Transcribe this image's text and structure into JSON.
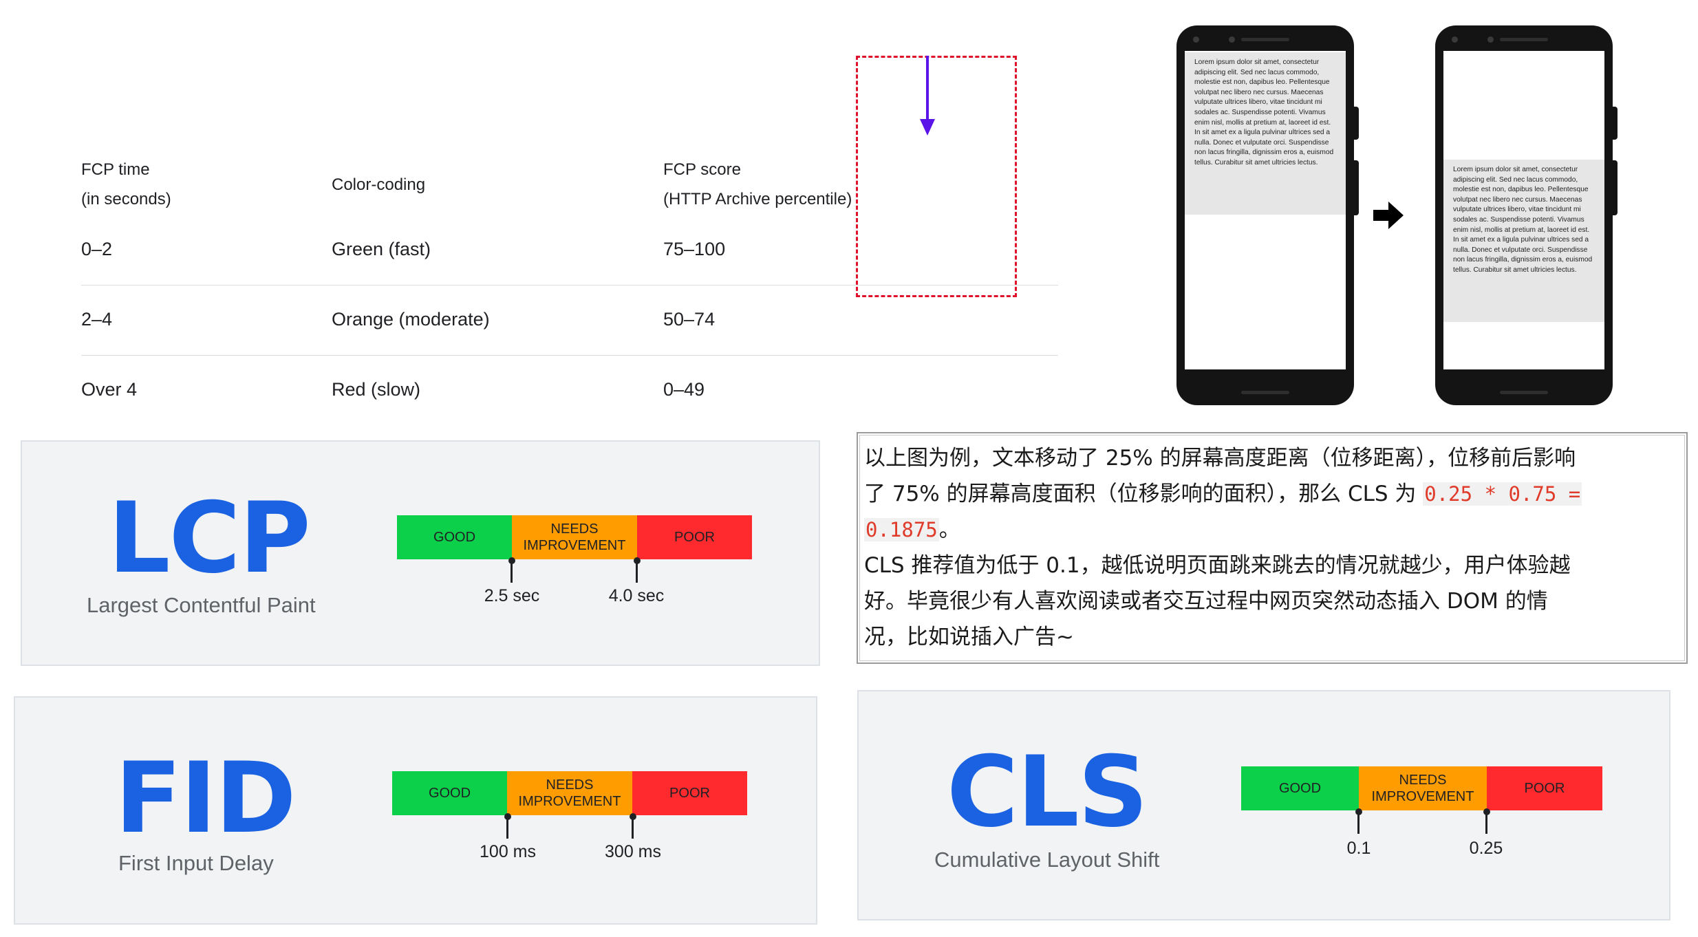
{
  "fcp_table": {
    "headers": {
      "time_line1": "FCP time",
      "time_line2": "(in seconds)",
      "color": "Color-coding",
      "score_line1": "FCP score",
      "score_line2": "(HTTP Archive percentile)"
    },
    "rows": [
      {
        "time": "0–2",
        "color": "Green (fast)",
        "score": "75–100"
      },
      {
        "time": "2–4",
        "color": "Orange (moderate)",
        "score": "50–74"
      },
      {
        "time": "Over 4",
        "color": "Red (slow)",
        "score": "0–49"
      }
    ]
  },
  "phones": {
    "lorem": "Lorem ipsum dolor sit amet, consectetur adipiscing elit. Sed nec lacus commodo, molestie est non, dapibus leo. Pellentesque volutpat nec libero nec cursus. Maecenas vulputate ultrices libero, vitae tincidunt mi sodales ac. Suspendisse potenti. Vivamus enim nisl, mollis at pretium at, laoreet id est. In sit amet ex a ligula pulvinar ultrices sed a nulla. Donec et vulputate orci. Suspendisse non lacus fringilla, dignissim eros a, euismod tellus. Curabitur sit amet ultricies lectus.",
    "colors": {
      "shift_border": "#e0112b",
      "shift_arrow": "#5a14e8"
    }
  },
  "note": {
    "line1": "以上图为例，文本移动了 25% 的屏幕高度距离（位移距离），位移前后影响",
    "line2_text": "了 75% 的屏幕高度面积（位移影响的面积），那么 CLS 为 ",
    "line2_code": "0.25 * 0.75 =",
    "line3_code": "0.1875",
    "line3_text": "。",
    "line4": "CLS 推荐值为低于 0.1，越低说明页面跳来跳去的情况就越少，用户体验越",
    "line5": "好。毕竟很少有人喜欢阅读或者交互过程中网页突然动态插入 DOM 的情",
    "line6": "况，比如说插入广告~"
  },
  "scale_labels": {
    "good": "GOOD",
    "needs_line1": "NEEDS",
    "needs_line2": "IMPROVEMENT",
    "poor": "POOR"
  },
  "metrics": {
    "lcp": {
      "abbr": "LCP",
      "name": "Largest Contentful Paint",
      "threshold1": "2.5 sec",
      "threshold2": "4.0 sec"
    },
    "fid": {
      "abbr": "FID",
      "name": "First Input Delay",
      "threshold1": "100 ms",
      "threshold2": "300 ms"
    },
    "cls": {
      "abbr": "CLS",
      "name": "Cumulative Layout Shift",
      "threshold1": "0.1",
      "threshold2": "0.25"
    }
  },
  "colors": {
    "metric_blue": "#1a62e2",
    "good": "#0ccf4a",
    "needs_improvement": "#ff9c00",
    "poor": "#ff2a2e"
  }
}
